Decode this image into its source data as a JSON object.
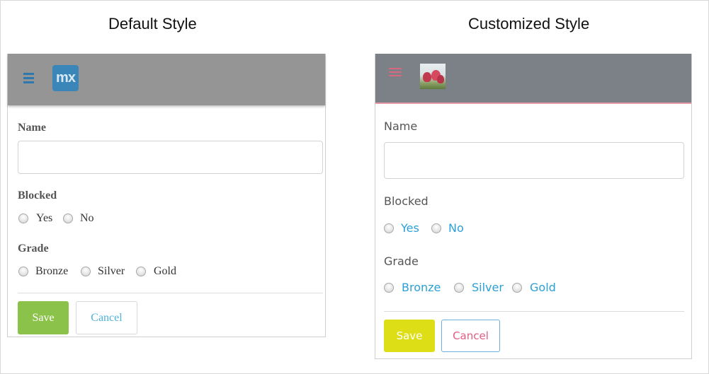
{
  "captions": {
    "default": "Default Style",
    "customized": "Customized Style"
  },
  "default_panel": {
    "logo_text": "mx",
    "name_label": "Name",
    "name_value": "",
    "blocked_label": "Blocked",
    "blocked_options": [
      "Yes",
      "No"
    ],
    "grade_label": "Grade",
    "grade_options": [
      "Bronze",
      "Silver",
      "Gold"
    ],
    "save_label": "Save",
    "cancel_label": "Cancel",
    "colors": {
      "header_bg": "#959595",
      "menu_icon": "#2f78ad",
      "save_bg": "#8bc34a",
      "cancel_text": "#4fb3dd"
    }
  },
  "custom_panel": {
    "name_label": "Name",
    "name_value": "",
    "blocked_label": "Blocked",
    "blocked_options": [
      "Yes",
      "No"
    ],
    "grade_label": "Grade",
    "grade_options": [
      "Bronze",
      "Silver",
      "Gold"
    ],
    "save_label": "Save",
    "cancel_label": "Cancel",
    "colors": {
      "header_bg": "#7c8087",
      "header_underline": "#e79aa6",
      "menu_icon": "#d7687f",
      "option_text": "#2aa0d8",
      "save_bg": "#dede17",
      "cancel_text": "#e35d82",
      "cancel_border": "#6ab0d8"
    }
  }
}
